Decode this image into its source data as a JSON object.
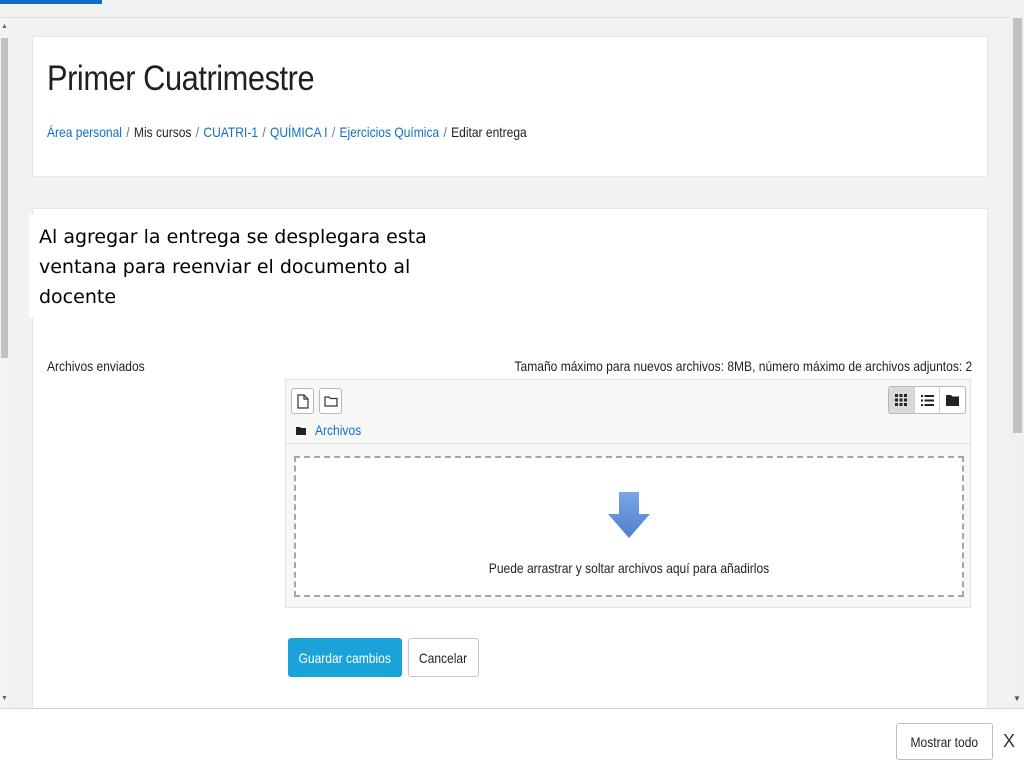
{
  "header": {
    "title": "Primer Cuatrimestre",
    "breadcrumb": [
      {
        "label": "Área personal",
        "link": true
      },
      {
        "label": "Mis cursos",
        "link": false
      },
      {
        "label": "CUATRI-1",
        "link": true
      },
      {
        "label": "QUÍMICA I",
        "link": true
      },
      {
        "label": "Ejercicios Química",
        "link": true
      },
      {
        "label": "Editar entrega",
        "link": false
      }
    ],
    "separator": "/"
  },
  "callout": {
    "text": "Al agregar la entrega se desplegara esta ventana para reenviar el documento al docente"
  },
  "form": {
    "files_label": "Archivos enviados",
    "limits_text": "Tamaño máximo para nuevos archivos: 8MB, número máximo de archivos adjuntos: 2",
    "filemanager": {
      "add_file_icon": "file-icon",
      "create_folder_icon": "folder-icon",
      "views": [
        "icon-view",
        "list-view",
        "tree-view"
      ],
      "active_view": "icon-view",
      "path_label": "Archivos",
      "drop_text": "Puede arrastrar y soltar archivos aquí para añadirlos"
    },
    "save_label": "Guardar cambios",
    "cancel_label": "Cancelar"
  },
  "download_bar": {
    "show_all_label": "Mostrar todo",
    "close_label": "X"
  },
  "colors": {
    "link": "#0f6fc5",
    "primary_button": "#1aa3d9",
    "drop_arrow": "#5b8fd6"
  }
}
